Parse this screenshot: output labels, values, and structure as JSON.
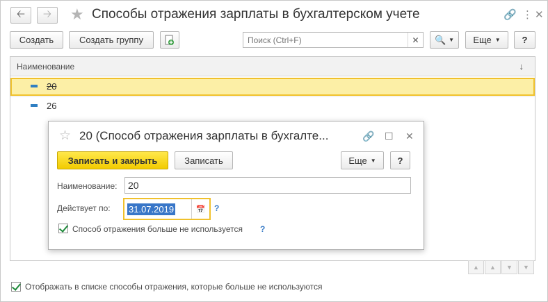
{
  "window": {
    "title": "Способы отражения зарплаты в бухгалтерском учете"
  },
  "toolbar": {
    "create_label": "Создать",
    "create_group_label": "Создать группу",
    "search_placeholder": "Поиск (Ctrl+F)",
    "more_label": "Еще",
    "help_label": "?"
  },
  "list": {
    "column_header": "Наименование",
    "rows": [
      {
        "name": "20",
        "selected": true,
        "deprecated": true
      },
      {
        "name": "26",
        "selected": false,
        "deprecated": false
      }
    ]
  },
  "dialog": {
    "title": "20 (Способ отражения зарплаты в бухгалте...",
    "save_close_label": "Записать и закрыть",
    "save_label": "Записать",
    "more_label": "Еще",
    "help_label": "?",
    "name_label": "Наименование:",
    "name_value": "20",
    "valid_from_label": "Действует по:",
    "valid_from_value": "31.07.2019",
    "deprecated_checkbox_label": "Способ отражения больше не используется",
    "field_help": "?"
  },
  "footer": {
    "show_deprecated_label": "Отображать в списке способы отражения, которые больше не используются"
  },
  "colors": {
    "accent_yellow": "#f2cb00",
    "selection_border": "#f0c12c",
    "row_marker": "#2f7fc2",
    "help_blue": "#3a7cc7"
  }
}
